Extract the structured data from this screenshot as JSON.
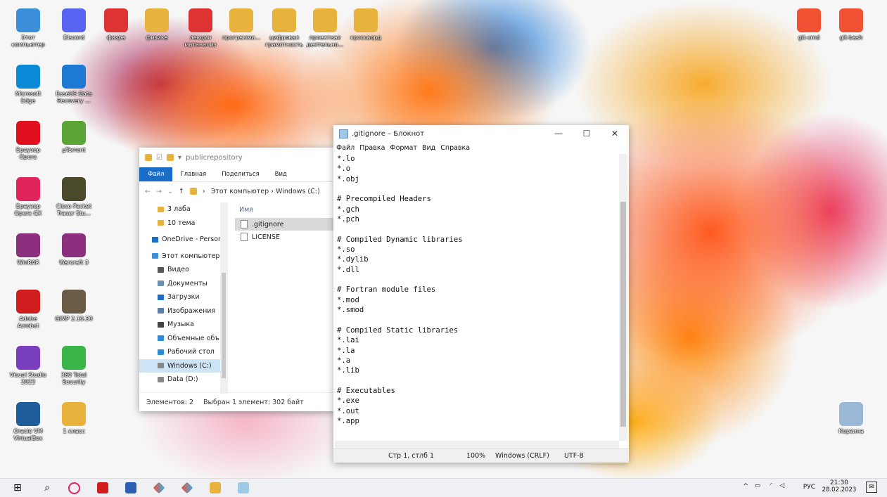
{
  "desktop": {
    "icons": [
      {
        "name": "this-pc",
        "label": "Этот\nкомпьютер",
        "color": "#3b8ed8"
      },
      {
        "name": "discord",
        "label": "Discord",
        "color": "#5865f2"
      },
      {
        "name": "fizra",
        "label": "физра",
        "color": "#d33"
      },
      {
        "name": "fizika",
        "label": "физика",
        "color": "#e8b33c"
      },
      {
        "name": "lekcii",
        "label": "лекции\nматанализ",
        "color": "#d33"
      },
      {
        "name": "programm",
        "label": "программи...",
        "color": "#e8b33c"
      },
      {
        "name": "cifrovaya",
        "label": "цифровая\nграмотность",
        "color": "#e8b33c"
      },
      {
        "name": "proekt",
        "label": "проектная\nдеятельно...",
        "color": "#e8b33c"
      },
      {
        "name": "krossvord",
        "label": "кроссворд",
        "color": "#e8b33c"
      },
      {
        "name": "edge",
        "label": "Microsoft\nEdge",
        "color": "#0b8ad8"
      },
      {
        "name": "easeus",
        "label": "EaseUS Data\nRecovery ...",
        "color": "#1d79d1"
      },
      {
        "name": "opera",
        "label": "Браузер\nOpera",
        "color": "#e0101e"
      },
      {
        "name": "utorrent",
        "label": "µTorrent",
        "color": "#5aa535"
      },
      {
        "name": "opera-gx",
        "label": "Браузер\nOpera GX",
        "color": "#e1255c"
      },
      {
        "name": "cisco",
        "label": "Cisco Packet\nTracer Stu...",
        "color": "#4a4a2a"
      },
      {
        "name": "winrar",
        "label": "WinRAR",
        "color": "#8b2f7e"
      },
      {
        "name": "warcraft",
        "label": "Warcraft 3",
        "color": "#8b2f7e"
      },
      {
        "name": "acrobat",
        "label": "Adobe\nAcrobat",
        "color": "#d01e1e"
      },
      {
        "name": "gimp",
        "label": "GIMP 2.10.30",
        "color": "#6b5c48"
      },
      {
        "name": "vs2022",
        "label": "Visual Studio\n2022",
        "color": "#7a3fbf"
      },
      {
        "name": "360",
        "label": "360 Total\nSecurity",
        "color": "#3bb449"
      },
      {
        "name": "virtualbox",
        "label": "Oracle VM\nVirtualBox",
        "color": "#1f5d9a"
      },
      {
        "name": "one-class",
        "label": "1 класс",
        "color": "#e8b33c"
      },
      {
        "name": "git-cmd",
        "label": "git-cmd",
        "color": "#f05133"
      },
      {
        "name": "git-bash",
        "label": "git-bash",
        "color": "#f05133"
      },
      {
        "name": "recycle",
        "label": "Корзина",
        "color": "#9ab7d6"
      }
    ]
  },
  "explorer": {
    "title": "publicrepository",
    "ribbon": [
      "Файл",
      "Главная",
      "Поделиться",
      "Вид"
    ],
    "nav_buttons": [
      "←",
      "→",
      "⌄",
      "↑"
    ],
    "address": "Этот компьютер  ›  Windows (C:)",
    "tree": [
      {
        "label": "3 лаба",
        "type": "folder"
      },
      {
        "label": "10 тема",
        "type": "folder"
      },
      {
        "label": "OneDrive - Person",
        "type": "cloud"
      },
      {
        "label": "Этот компьютер",
        "type": "pc"
      },
      {
        "label": "Видео",
        "type": "video"
      },
      {
        "label": "Документы",
        "type": "docs"
      },
      {
        "label": "Загрузки",
        "type": "down"
      },
      {
        "label": "Изображения",
        "type": "img"
      },
      {
        "label": "Музыка",
        "type": "music"
      },
      {
        "label": "Объемные объ",
        "type": "3d"
      },
      {
        "label": "Рабочий стол",
        "type": "desk"
      },
      {
        "label": "Windows (C:)",
        "type": "drive"
      },
      {
        "label": "Data (D:)",
        "type": "drive"
      }
    ],
    "column": "Имя",
    "files": [
      ".gitignore",
      "LICENSE"
    ],
    "status_count": "Элементов: 2",
    "status_selected": "Выбран 1 элемент: 302 байт"
  },
  "notepad": {
    "title": ".gitignore – Блокнот",
    "controls": [
      "—",
      "☐",
      "✕"
    ],
    "menu": [
      "Файл",
      "Правка",
      "Формат",
      "Вид",
      "Справка"
    ],
    "lines": [
      "*.lo",
      "*.o",
      "*.obj",
      "",
      "# Precompiled Headers",
      "*.gch",
      "*.pch",
      "",
      "# Compiled Dynamic libraries",
      "*.so",
      "*.dylib",
      "*.dll",
      "",
      "# Fortran module files",
      "*.mod",
      "*.smod",
      "",
      "# Compiled Static libraries",
      "*.lai",
      "*.la",
      "*.a",
      "*.lib",
      "",
      "# Executables",
      "*.exe",
      "*.out",
      "*.app"
    ],
    "status": {
      "position": "Стр 1, стлб 1",
      "zoom": "100%",
      "eol": "Windows (CRLF)",
      "encoding": "UTF-8"
    }
  },
  "taskbar": {
    "tray_lang": "РУС",
    "time": "21:30",
    "date": "28.02.2023",
    "tray_arrow": "^"
  }
}
